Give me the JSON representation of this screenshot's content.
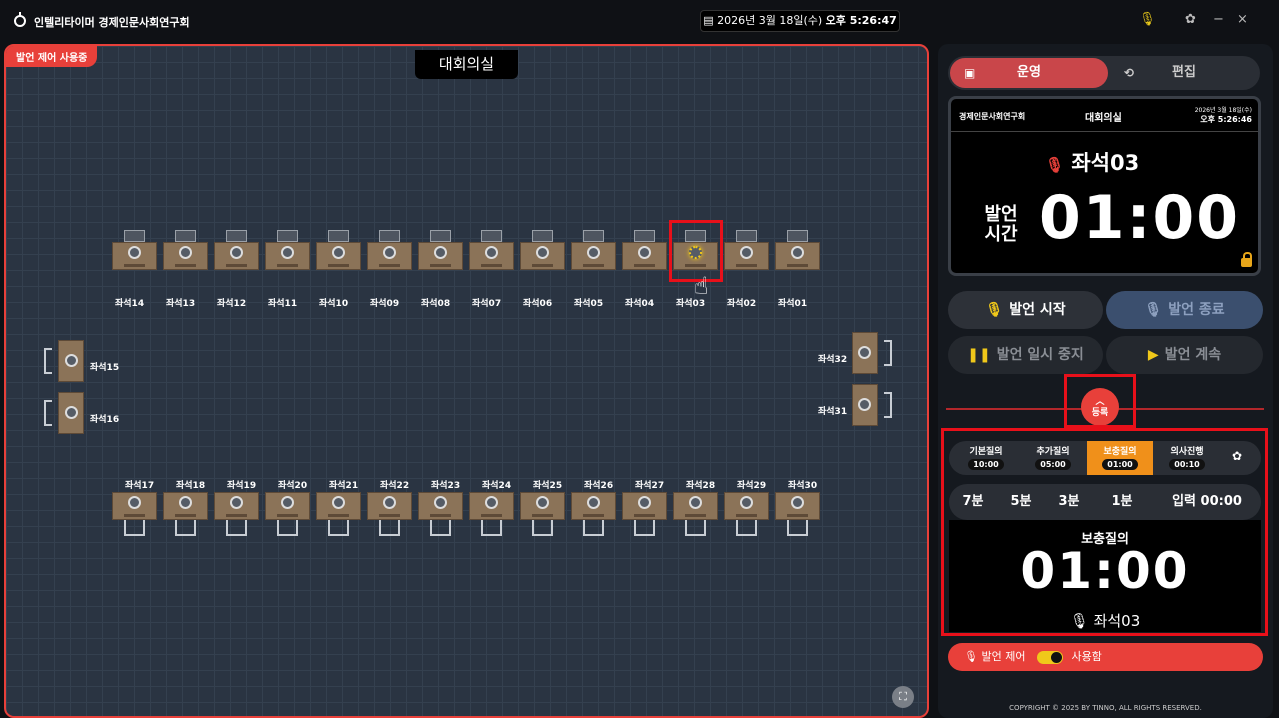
{
  "window": {
    "title": "인텔리타이머 경제인문사회연구회",
    "date_text": "2026년 3월 18일(수)",
    "time_text": "오후 5:26:47",
    "mic_icon": "mic-icon",
    "settings_icon": "gear-icon",
    "minimize": "−",
    "close": "×"
  },
  "floor": {
    "badge": "발언 제어 사용중",
    "room_name": "대회의실",
    "top_row": [
      "좌석14",
      "좌석13",
      "좌석12",
      "좌석11",
      "좌석10",
      "좌석09",
      "좌석08",
      "좌석07",
      "좌석06",
      "좌석05",
      "좌석04",
      "좌석03",
      "좌석02",
      "좌석01"
    ],
    "bottom_row": [
      "좌석17",
      "좌석18",
      "좌석19",
      "좌석20",
      "좌석21",
      "좌석22",
      "좌석23",
      "좌석24",
      "좌석25",
      "좌석26",
      "좌석27",
      "좌석28",
      "좌석29",
      "좌석30"
    ],
    "left_side": [
      "좌석15",
      "좌석16"
    ],
    "right_side": [
      "좌석32",
      "좌석31"
    ],
    "active_seat": "좌석03"
  },
  "panel": {
    "mode_active": "운영",
    "mode_inactive": "편집",
    "display": {
      "org": "경제인문사회연구회",
      "room": "대회의실",
      "date": "2026년 3월 18일(수)",
      "time": "오후 5:26:46",
      "speaker": "좌석03",
      "label": "발언 시간",
      "timer": "01:00"
    },
    "buttons": {
      "start": "발언 시작",
      "end": "발언 종료",
      "pause": "발언 일시 중지",
      "resume": "발언 계속"
    },
    "register": "등록",
    "question_types": [
      {
        "name": "기본질의",
        "time": "10:00"
      },
      {
        "name": "추가질의",
        "time": "05:00"
      },
      {
        "name": "보충질의",
        "time": "01:00"
      },
      {
        "name": "의사진행",
        "time": "00:10"
      }
    ],
    "active_question_index": 2,
    "presets": [
      "7분",
      "5분",
      "3분",
      "1분",
      "입력 00:00"
    ],
    "qdisplay": {
      "title": "보충질의",
      "timer": "01:00",
      "speaker": "좌석03"
    },
    "control": {
      "label": "발언 제어",
      "state": "사용함"
    },
    "copyright": "COPYRIGHT © 2025 BY TINNO, ALL RIGHTS RESERVED."
  },
  "colors": {
    "accent_red": "#e8403a",
    "highlight_orange": "#f0901a",
    "start_yellow": "#f0c81a",
    "end_blue": "#3b4f6e"
  }
}
